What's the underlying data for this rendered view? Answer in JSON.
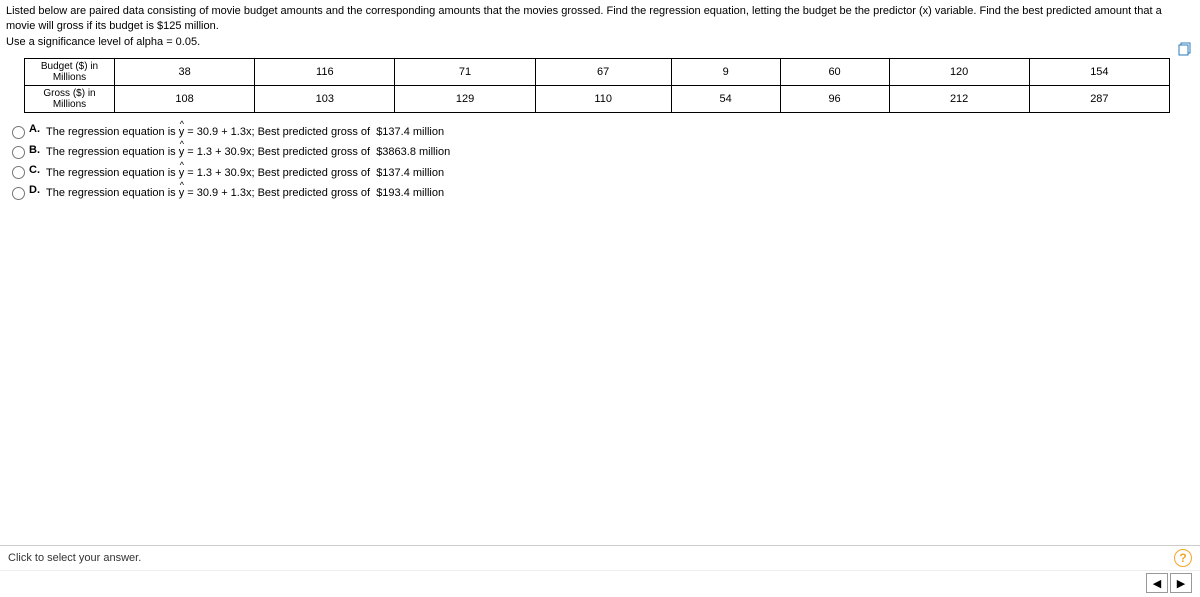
{
  "question": {
    "line1": "Listed below are paired data consisting of movie budget amounts and the corresponding amounts that the movies grossed.  Find the regression equation, letting the budget be the predictor (x) variable.  Find the best predicted amount that a movie will gross if its budget is $125 million.",
    "line2": "Use a significance level of alpha = 0.05."
  },
  "table": {
    "row1_header": "Budget ($) in Millions",
    "row2_header": "Gross ($) in Millions",
    "budget": [
      "38",
      "116",
      "71",
      "67",
      "9",
      "60",
      "120",
      "154"
    ],
    "gross": [
      "108",
      "103",
      "129",
      "110",
      "54",
      "96",
      "212",
      "287"
    ]
  },
  "choices": {
    "A": {
      "label": "A.",
      "text": "The regression equation is ŷ = 30.9 + 1.3x; Best predicted gross of  $137.4 million"
    },
    "B": {
      "label": "B.",
      "text": "The regression equation is ŷ = 1.3 + 30.9x; Best predicted gross of  $3863.8 million"
    },
    "C": {
      "label": "C.",
      "text": "The regression equation is ŷ = 1.3 + 30.9x; Best predicted gross of  $137.4 million"
    },
    "D": {
      "label": "D.",
      "text": "The regression equation is ŷ = 30.9 + 1.3x; Best predicted gross of  $193.4 million"
    }
  },
  "footer": {
    "instruction": "Click to select your answer.",
    "help": "?",
    "prev": "◀",
    "next": "▶"
  }
}
